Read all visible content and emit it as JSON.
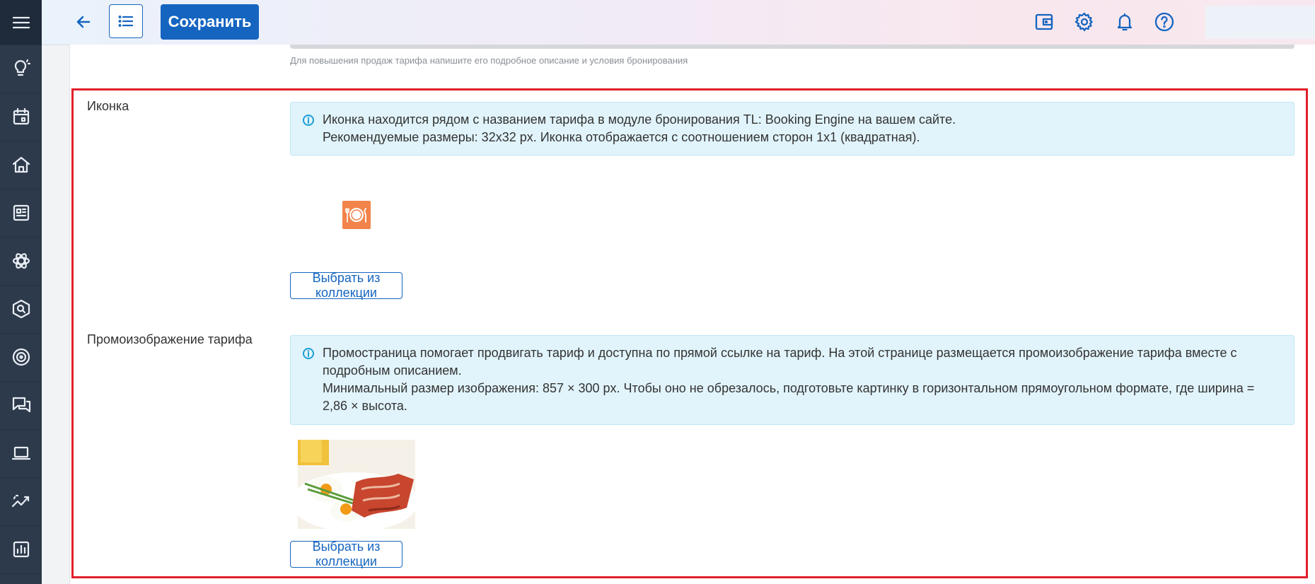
{
  "topbar": {
    "save_label": "Сохранить"
  },
  "main": {
    "previous_field_hint": "Для повышения продаж тарифа напишите его подробное описание и условия бронирования",
    "icon_section": {
      "label": "Иконка",
      "info_lines": [
        "Иконка находится рядом с названием тарифа в модуле бронирования TL: Booking Engine на вашем сайте.",
        "Рекомендуемые размеры: 32х32 px. Иконка отображается с соотношением сторон 1x1 (квадратная)."
      ],
      "button_label": "Выбрать из коллекции",
      "icon_color": "#f2834a"
    },
    "promo_section": {
      "label": "Промоизображение тарифа",
      "info_lines": [
        "Промостраница помогает продвигать тариф и доступна по прямой ссылке на тариф. На этой странице размещается промоизображение тарифа вместе с подробным описанием.",
        "Минимальный размер изображения: 857 × 300 px. Чтобы оно не обрезалось, подготовьте картинку в горизонтальном прямоугольном формате, где ширина = 2,86 × высота."
      ],
      "button_label": "Выбрать из коллекции"
    }
  },
  "colors": {
    "accent": "#1565c0",
    "sidebar": "#2d3a4b",
    "highlight_border": "#e0202b",
    "info_bg": "#e1f4fb"
  },
  "sidebar": {
    "icons": [
      "menu-icon",
      "lightbulb-icon",
      "calendar-icon",
      "home-icon",
      "dashboard-icon",
      "atom-icon",
      "search-hex-icon",
      "target-icon",
      "chat-icon",
      "laptop-icon",
      "trend-icon",
      "bar-chart-icon"
    ]
  }
}
